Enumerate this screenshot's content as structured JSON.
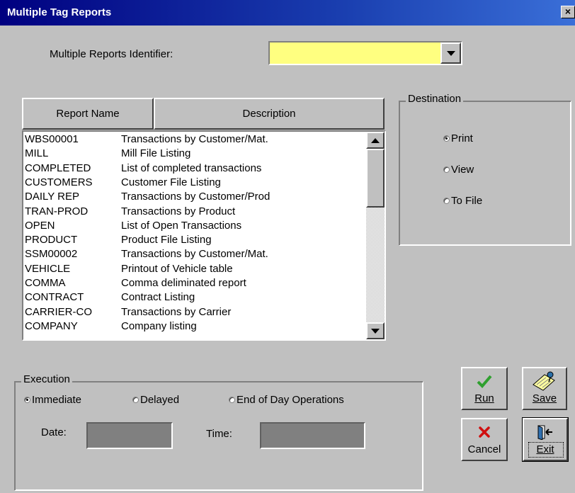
{
  "window": {
    "title": "Multiple Tag Reports",
    "close_glyph": "×"
  },
  "identifier": {
    "label": "Multiple Reports Identifier:",
    "value": ""
  },
  "columns": {
    "name": "Report Name",
    "description": "Description"
  },
  "reports": [
    {
      "name": "WBS00001",
      "description": "Transactions by Customer/Mat."
    },
    {
      "name": "MILL",
      "description": "Mill File Listing"
    },
    {
      "name": "COMPLETED",
      "description": "List of completed transactions"
    },
    {
      "name": "CUSTOMERS",
      "description": "Customer File Listing"
    },
    {
      "name": "DAILY REP",
      "description": "Transactions by Customer/Prod"
    },
    {
      "name": "TRAN-PROD",
      "description": "Transactions by Product"
    },
    {
      "name": "OPEN",
      "description": "List of Open Transactions"
    },
    {
      "name": "PRODUCT",
      "description": "Product File Listing"
    },
    {
      "name": "SSM00002",
      "description": "Transactions by Customer/Mat."
    },
    {
      "name": "VEHICLE",
      "description": "Printout of Vehicle table"
    },
    {
      "name": "COMMA",
      "description": "Comma deliminated report"
    },
    {
      "name": "CONTRACT",
      "description": "Contract Listing"
    },
    {
      "name": "CARRIER-CO",
      "description": "Transactions by Carrier"
    },
    {
      "name": "COMPANY",
      "description": "Company listing"
    }
  ],
  "destination": {
    "legend": "Destination",
    "options": [
      "Print",
      "View",
      "To File"
    ],
    "selected": "Print"
  },
  "execution": {
    "legend": "Execution",
    "options": [
      "Immediate",
      "Delayed",
      "End of Day Operations"
    ],
    "selected": "Immediate",
    "date_label": "Date:",
    "time_label": "Time:",
    "date_value": "",
    "time_value": ""
  },
  "buttons": {
    "run": "Run",
    "save": "Save",
    "cancel": "Cancel",
    "exit": "Exit"
  },
  "colors": {
    "title_bar": "#000080",
    "identifier_field": "#ffff80",
    "run_icon": "#2fa02f",
    "cancel_icon": "#d01010"
  },
  "icons": {
    "run": "checkmark-icon",
    "save": "notepad-pushpin-icon",
    "cancel": "x-icon",
    "exit": "door-exit-icon"
  }
}
